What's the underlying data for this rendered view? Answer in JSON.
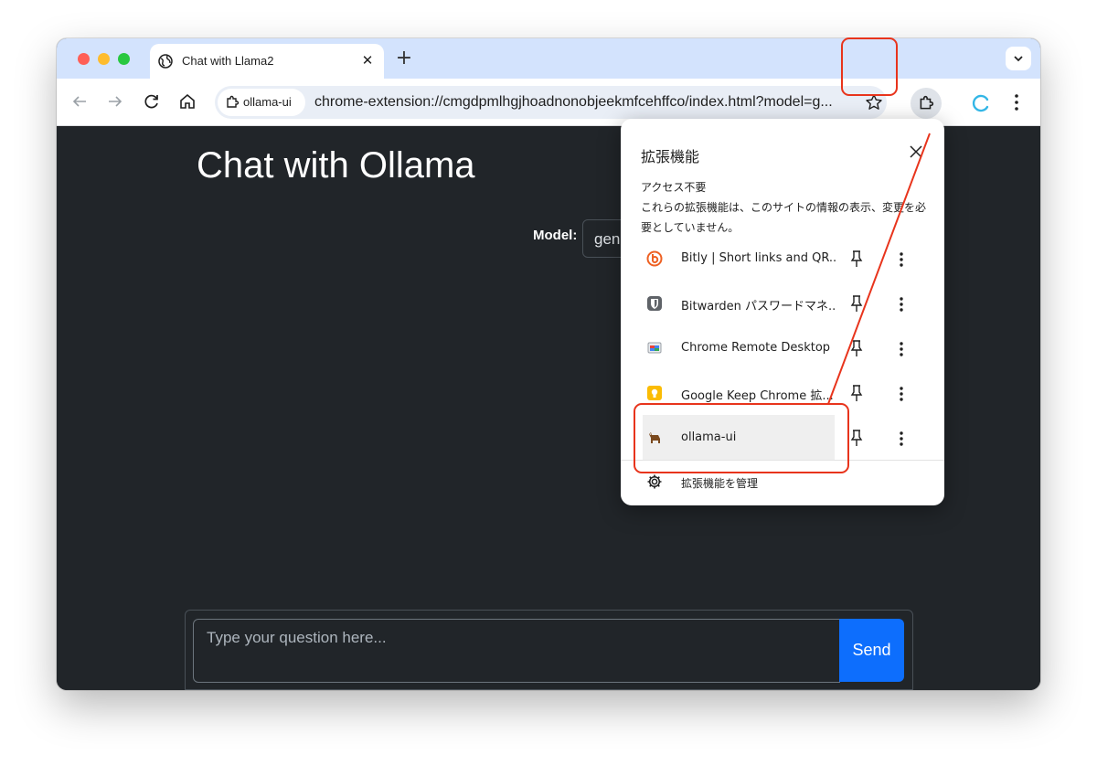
{
  "browser": {
    "tab_title": "Chat with Llama2",
    "tab_close": "✕",
    "new_tab": "+",
    "chip_label": "ollama-ui",
    "url": "chrome-extension://cmgdpmlhgjhoadnonobjeekmfcehffco/index.html?model=g..."
  },
  "page": {
    "title": "Chat with Ollama",
    "model_label": "Model:",
    "model_value": "gen",
    "question_placeholder": "Type your question here...",
    "send_label": "Send"
  },
  "extensions_popup": {
    "title": "拡張機能",
    "section_heading": "アクセス不要",
    "section_desc": "これらの拡張機能は、このサイトの情報の表示、変更を必要としていません。",
    "items": [
      {
        "name": "Bitly | Short links and QR...",
        "icon": "bitly-icon",
        "color": "#ee6123"
      },
      {
        "name": "Bitwarden パスワードマネ...",
        "icon": "bitwarden-icon",
        "color": "#5f6368"
      },
      {
        "name": "Chrome Remote Desktop",
        "icon": "chrome-remote-desktop-icon",
        "color": "#4285f4"
      },
      {
        "name": "Google Keep Chrome 拡...",
        "icon": "google-keep-icon",
        "color": "#fbbc04"
      },
      {
        "name": "ollama-ui",
        "icon": "llama-icon",
        "color": "#7b4a1e"
      }
    ],
    "manage_label": "拡張機能を管理"
  },
  "colors": {
    "accent_red": "#e8341c",
    "send_blue": "#0d6efd",
    "page_bg": "#212529",
    "tabstrip_bg": "#d3e3fd"
  }
}
